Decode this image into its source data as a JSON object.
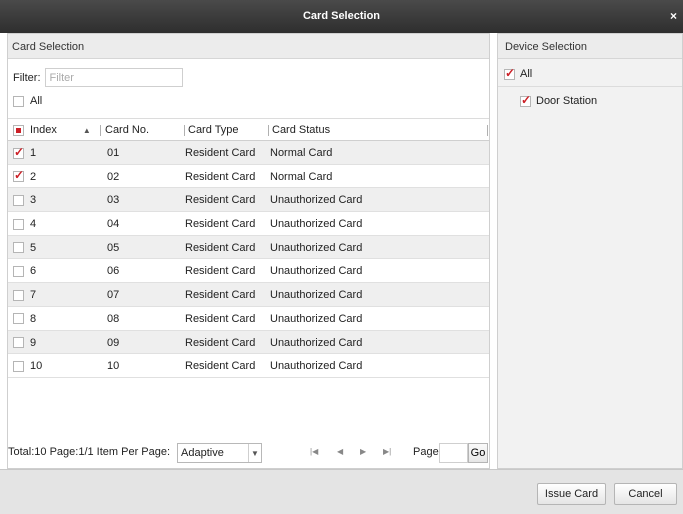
{
  "window": {
    "title": "Card Selection",
    "close_glyph": "×"
  },
  "left_panel": {
    "header": "Card Selection",
    "filter_label": "Filter:",
    "filter_placeholder": "Filter",
    "filter_value": "",
    "all_label": "All",
    "all_checked": false
  },
  "table": {
    "columns": [
      "Index",
      "Card No.",
      "Card Type",
      "Card Status"
    ],
    "header_checkbox": "partial",
    "rows": [
      {
        "checked": true,
        "index": "1",
        "card_no": "01",
        "card_type": "Resident Card",
        "card_status": "Normal Card"
      },
      {
        "checked": true,
        "index": "2",
        "card_no": "02",
        "card_type": "Resident Card",
        "card_status": "Normal Card"
      },
      {
        "checked": false,
        "index": "3",
        "card_no": "03",
        "card_type": "Resident Card",
        "card_status": "Unauthorized Card"
      },
      {
        "checked": false,
        "index": "4",
        "card_no": "04",
        "card_type": "Resident Card",
        "card_status": "Unauthorized Card"
      },
      {
        "checked": false,
        "index": "5",
        "card_no": "05",
        "card_type": "Resident Card",
        "card_status": "Unauthorized Card"
      },
      {
        "checked": false,
        "index": "6",
        "card_no": "06",
        "card_type": "Resident Card",
        "card_status": "Unauthorized Card"
      },
      {
        "checked": false,
        "index": "7",
        "card_no": "07",
        "card_type": "Resident Card",
        "card_status": "Unauthorized Card"
      },
      {
        "checked": false,
        "index": "8",
        "card_no": "08",
        "card_type": "Resident Card",
        "card_status": "Unauthorized Card"
      },
      {
        "checked": false,
        "index": "9",
        "card_no": "09",
        "card_type": "Resident Card",
        "card_status": "Unauthorized Card"
      },
      {
        "checked": false,
        "index": "10",
        "card_no": "10",
        "card_type": "Resident Card",
        "card_status": "Unauthorized Card"
      }
    ]
  },
  "pagination": {
    "summary": "Total:10  Page:1/1  Item Per Page:",
    "per_page_value": "Adaptive",
    "page_label": "Page",
    "page_input": "",
    "go_label": "Go"
  },
  "right_panel": {
    "header": "Device Selection",
    "all_label": "All",
    "all_checked": true,
    "devices": [
      {
        "label": "Door Station",
        "checked": true
      }
    ]
  },
  "buttons": {
    "issue_card": "Issue Card",
    "cancel": "Cancel"
  },
  "colors": {
    "accent": "#cc2027",
    "titlebar": "#3a3a3a",
    "row_alt": "#efefef",
    "bottombar": "#e4e4e4"
  },
  "icons": [
    "close-icon",
    "sort-ascending-icon",
    "chevron-down-icon",
    "first-page-icon",
    "previous-page-icon",
    "next-page-icon",
    "last-page-icon",
    "checkbox-icon"
  ]
}
